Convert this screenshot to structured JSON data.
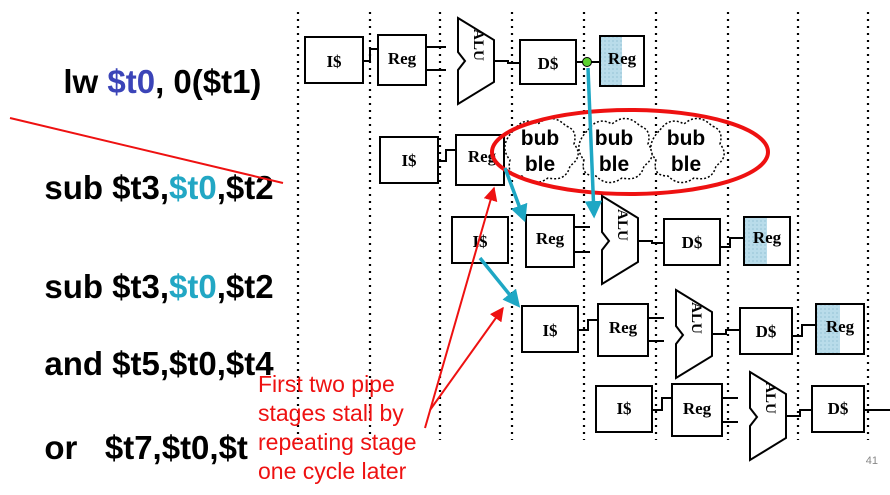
{
  "instructions": [
    {
      "parts": [
        {
          "text": "lw ",
          "color": "black"
        },
        {
          "text": "$t0",
          "color": "blue"
        },
        {
          "text": ", 0($t1)",
          "color": "black"
        }
      ]
    },
    {
      "parts": [
        {
          "text": "sub $t3,",
          "color": "black"
        },
        {
          "text": "$t0",
          "color": "cyan"
        },
        {
          "text": ",$t2",
          "color": "black"
        }
      ],
      "struck": true
    },
    {
      "parts": [
        {
          "text": "sub $t3,",
          "color": "black"
        },
        {
          "text": "$t0",
          "color": "cyan"
        },
        {
          "text": ",$t2",
          "color": "black"
        }
      ]
    },
    {
      "parts": [
        {
          "text": "and $t5,$t0,$t4",
          "color": "black"
        }
      ]
    },
    {
      "parts": [
        {
          "text": "or   $t7,$t0,$t",
          "color": "black"
        }
      ]
    }
  ],
  "stages": {
    "icache": "I$",
    "reg": "Reg",
    "alu": "ALU",
    "dcache": "D$"
  },
  "bubble": {
    "line1": "bub",
    "line2": "ble"
  },
  "annotation": [
    "First two pipe",
    "stages stall by",
    "repeating stage",
    "one cycle later"
  ],
  "colors": {
    "accent_red": "#ee1111",
    "arrow_cyan": "#1ea7c4",
    "reg_fill": "#b9dcea",
    "blue_text": "#3b44b8",
    "cyan_text": "#22a7c4"
  },
  "page_number": "41"
}
